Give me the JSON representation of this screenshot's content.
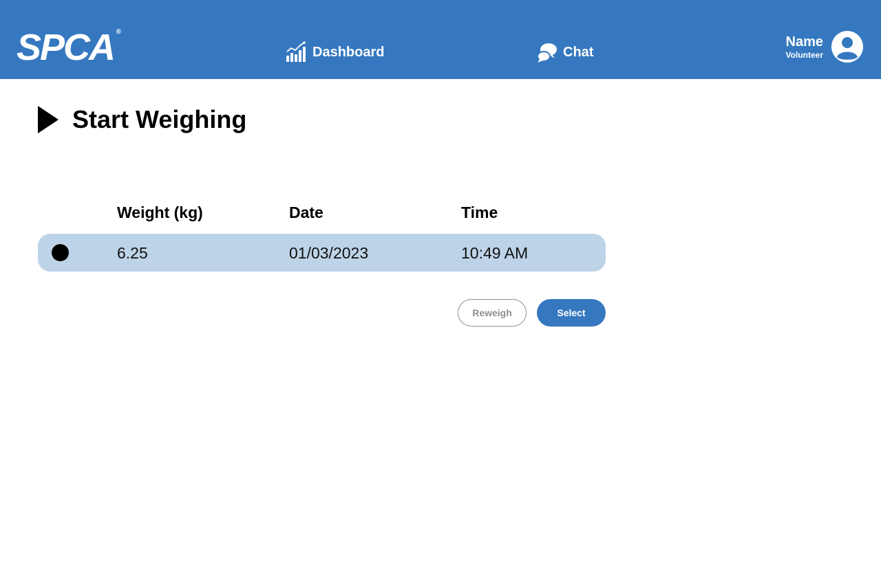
{
  "header": {
    "logo_text": "SPCA",
    "logo_reg": "®",
    "nav": {
      "dashboard_label": "Dashboard",
      "dashboard_icon": "bar-chart-icon",
      "chat_label": "Chat",
      "chat_icon": "chat-bubbles-icon"
    },
    "user": {
      "name": "Name",
      "role": "Volunteer",
      "avatar_icon": "user-avatar-icon"
    }
  },
  "main": {
    "title": "Start Weighing",
    "title_icon": "play-arrow-icon",
    "table": {
      "columns": [
        "Weight (kg)",
        "Date",
        "Time"
      ],
      "rows": [
        {
          "weight": "6.25",
          "date": "01/03/2023",
          "time": "10:49 AM",
          "selected": true
        }
      ]
    },
    "actions": {
      "reweigh_label": "Reweigh",
      "select_label": "Select"
    }
  },
  "colors": {
    "brand": "#3578c0",
    "row_highlight": "#bdd3e8",
    "secondary_text": "#8f8f8f"
  }
}
